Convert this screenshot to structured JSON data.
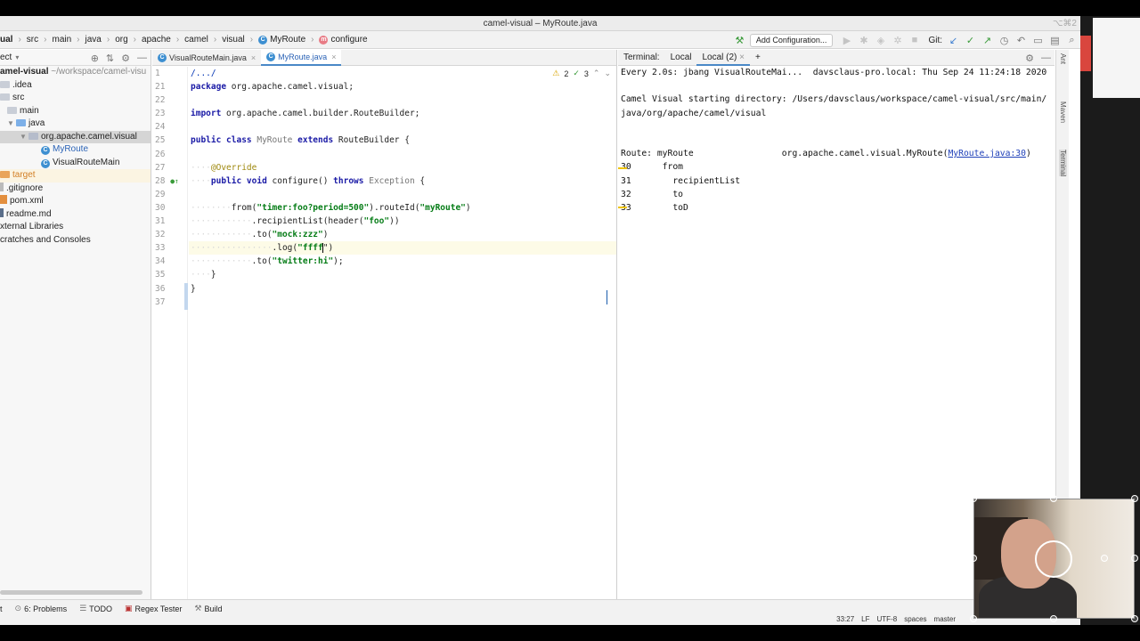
{
  "window": {
    "title": "camel-visual – MyRoute.java",
    "shortcut": "⌥⌘2"
  },
  "breadcrumb": {
    "items": [
      "ual",
      "src",
      "main",
      "java",
      "org",
      "apache",
      "camel",
      "visual",
      "MyRoute",
      "configure"
    ]
  },
  "toolbar": {
    "add_configuration": "Add Configuration...",
    "git_label": "Git:"
  },
  "project_panel": {
    "title": "ect",
    "tree": [
      {
        "label": "amel-visual",
        "suffix": "~/workspace/camel-visu",
        "kind": "root"
      },
      {
        "label": ".idea",
        "kind": "folder"
      },
      {
        "label": "src",
        "kind": "folder"
      },
      {
        "label": "main",
        "kind": "folder"
      },
      {
        "label": "java",
        "kind": "folder-blue"
      },
      {
        "label": "org.apache.camel.visual",
        "kind": "package"
      },
      {
        "label": "MyRoute",
        "kind": "class"
      },
      {
        "label": "VisualRouteMain",
        "kind": "class"
      },
      {
        "label": "target",
        "kind": "folder-orange"
      },
      {
        "label": ".gitignore",
        "kind": "file"
      },
      {
        "label": "pom.xml",
        "kind": "xml"
      },
      {
        "label": "readme.md",
        "kind": "md"
      },
      {
        "label": "xternal Libraries",
        "kind": "lib"
      },
      {
        "label": "cratches and Consoles",
        "kind": "scratch"
      }
    ]
  },
  "editor": {
    "tabs": [
      {
        "label": "VisualRouteMain.java",
        "active": false
      },
      {
        "label": "MyRoute.java",
        "active": true
      }
    ],
    "warnings": "2",
    "ok_count": "3",
    "line_numbers": [
      "1",
      "21",
      "22",
      "23",
      "24",
      "25",
      "26",
      "27",
      "28",
      "29",
      "30",
      "31",
      "32",
      "33",
      "34",
      "35",
      "36",
      "37"
    ],
    "code": {
      "l1": "/.../",
      "l21_kw": "package",
      "l21_rest": " org.apache.camel.visual;",
      "l23_kw": "import",
      "l23_rest": " org.apache.camel.builder.RouteBuilder;",
      "l25_kw1": "public class",
      "l25_name": " MyRoute ",
      "l25_kw2": "extends",
      "l25_rest": " RouteBuilder {",
      "l27_ann": "@Override",
      "l28_kw1": "public void",
      "l28_mid": " configure() ",
      "l28_kw2": "throws",
      "l28_exc": " Exception",
      "l28_end": " {",
      "l30_a": "from(",
      "l30_s1": "\"timer:foo?period=500\"",
      "l30_b": ").routeId(",
      "l30_s2": "\"myRoute\"",
      "l30_c": ")",
      "l31_a": ".recipientList(header(",
      "l31_s": "\"foo\"",
      "l31_b": "))",
      "l32_a": ".to(",
      "l32_s": "\"mock:zzz\"",
      "l32_b": ")",
      "l33_a": ".log(",
      "l33_s": "\"ffff",
      "l33_b": "\")",
      "l34_a": ".to(",
      "l34_s": "\"twitter:hi\"",
      "l34_b": ");",
      "l35": "}",
      "l36": "}"
    }
  },
  "terminal": {
    "label": "Terminal:",
    "tabs": [
      {
        "label": "Local",
        "active": false
      },
      {
        "label": "Local (2)",
        "active": true
      }
    ],
    "lines": {
      "watch": "Every 2.0s: jbang VisualRouteMai...  davsclaus-pro.local: Thu Sep 24 11:24:18 2020",
      "start1": "Camel Visual starting directory: /Users/davsclaus/workspace/camel-visual/src/main/",
      "start2": "java/org/apache/camel/visual",
      "route_prefix": "Route: myRoute                 org.apache.camel.visual.MyRoute(",
      "route_link": "MyRoute.java:30",
      "route_suffix": ")",
      "r30": "30      from",
      "r31": "31        recipientList",
      "r32": "32        to",
      "r33": "33        toD"
    }
  },
  "right_strip": {
    "items": [
      "Ant",
      "Maven",
      "Terminal"
    ]
  },
  "tool_windows": {
    "items": [
      {
        "label": "t",
        "icon": ""
      },
      {
        "label": "6: Problems",
        "icon": "problems-icon"
      },
      {
        "label": "TODO",
        "icon": "todo-icon"
      },
      {
        "label": "Regex Tester",
        "icon": "regex-icon"
      },
      {
        "label": "Build",
        "icon": "build-icon"
      }
    ]
  },
  "status": {
    "position": "33:27",
    "line_sep": "LF",
    "encoding": "UTF-8",
    "indent": "spaces",
    "branch": "master"
  },
  "colors": {
    "accent": "#4a88c7",
    "keyword": "#1a1aa6",
    "string": "#067d17",
    "annotation": "#9e880d"
  }
}
